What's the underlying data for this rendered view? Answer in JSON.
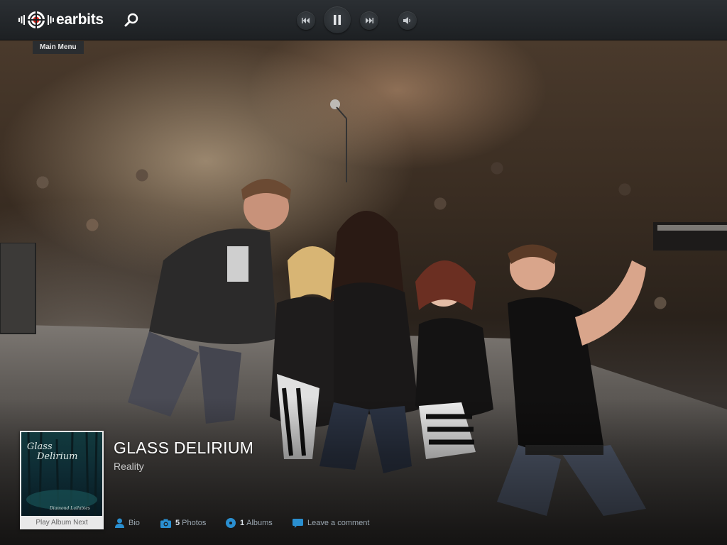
{
  "app": {
    "logo_text": "earbits"
  },
  "header": {
    "main_menu_label": "Main Menu",
    "icons": [
      "search-icon",
      "previous-icon",
      "pause-icon",
      "next-icon",
      "volume-icon"
    ]
  },
  "artist": {
    "name": "GLASS DELIRIUM",
    "album": "Reality"
  },
  "album_card": {
    "art_title_line1": "Glass",
    "art_title_line2": "Delirium",
    "art_subtitle": "Diamond Lullabies",
    "play_label": "Play Album Next"
  },
  "links": {
    "bio": {
      "label": "Bio"
    },
    "photos": {
      "count": "5",
      "label": "Photos"
    },
    "albums": {
      "count": "1",
      "label": "Albums"
    },
    "comment": {
      "label": "Leave a comment"
    }
  },
  "colors": {
    "topbar": "#2b2f33",
    "link_icon_blue": "#2a8fd0",
    "logo_red": "#e2231a"
  }
}
